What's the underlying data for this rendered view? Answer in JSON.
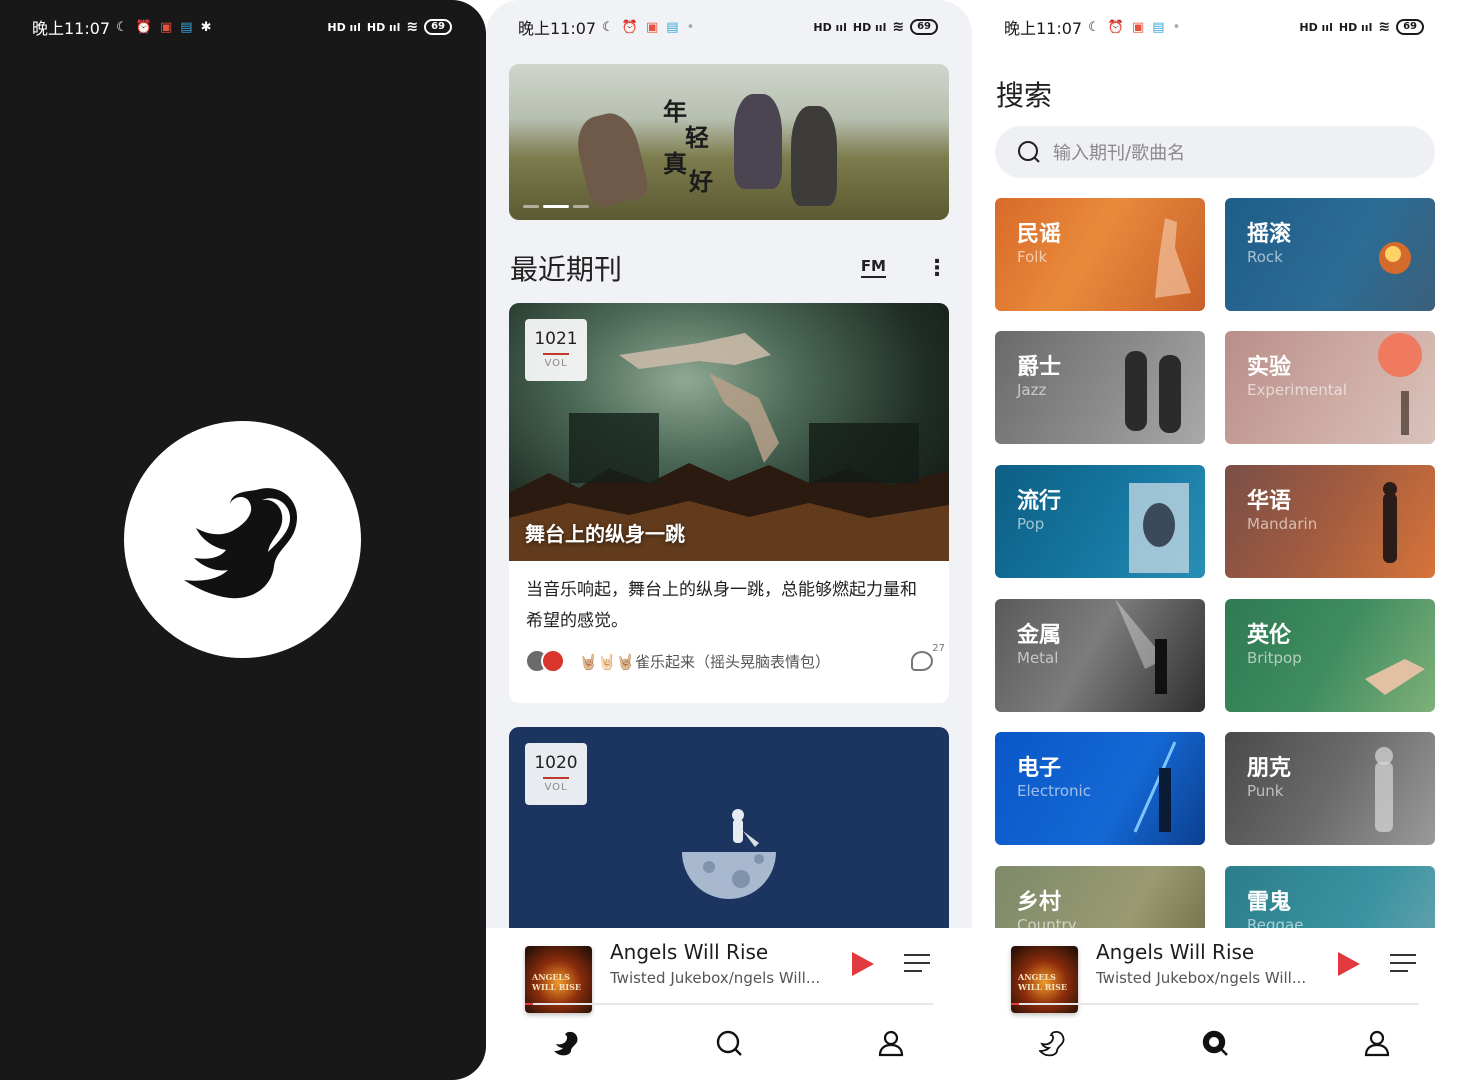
{
  "status_bar": {
    "time": "晚上11:07",
    "signal1": "HD ııl",
    "signal2": "HD ııl",
    "battery": "69"
  },
  "home": {
    "banner_poem": [
      "年",
      "轻",
      "真",
      "好"
    ],
    "section_title": "最近期刊",
    "fm_label": "FM",
    "more_icon": "more-vertical-icon",
    "cards": [
      {
        "vol_number": "1021",
        "vol_label": "VOL",
        "title": "舞台上的纵身一跳",
        "description": "当音乐响起，舞台上的纵身一跳，总能够燃起力量和希望的感觉。",
        "comment_text": "🤘🏼🤘🏻🤘🏼雀乐起来（摇头晃脑表情包）",
        "comment_count": "27"
      },
      {
        "vol_number": "1020",
        "vol_label": "VOL"
      }
    ]
  },
  "search": {
    "title": "搜索",
    "placeholder": "输入期刊/歌曲名",
    "genres": [
      {
        "zh": "民谣",
        "en": "Folk"
      },
      {
        "zh": "摇滚",
        "en": "Rock"
      },
      {
        "zh": "爵士",
        "en": "Jazz"
      },
      {
        "zh": "实验",
        "en": "Experimental"
      },
      {
        "zh": "流行",
        "en": "Pop"
      },
      {
        "zh": "华语",
        "en": "Mandarin"
      },
      {
        "zh": "金属",
        "en": "Metal"
      },
      {
        "zh": "英伦",
        "en": "Britpop"
      },
      {
        "zh": "电子",
        "en": "Electronic"
      },
      {
        "zh": "朋克",
        "en": "Punk"
      },
      {
        "zh": "乡村",
        "en": "Country"
      },
      {
        "zh": "雷鬼",
        "en": "Reggae"
      }
    ]
  },
  "player": {
    "title": "Angels Will Rise",
    "subtitle": "Twisted Jukebox/ngels Will...",
    "cover_text": "ANGELS WILL RISE",
    "progress": 0.02
  },
  "tabs": [
    "home-swan-icon",
    "search-icon",
    "profile-icon"
  ],
  "colors": {
    "accent": "#e0393e",
    "splash_bg": "#181818",
    "home_bg": "#f1f2f5"
  }
}
